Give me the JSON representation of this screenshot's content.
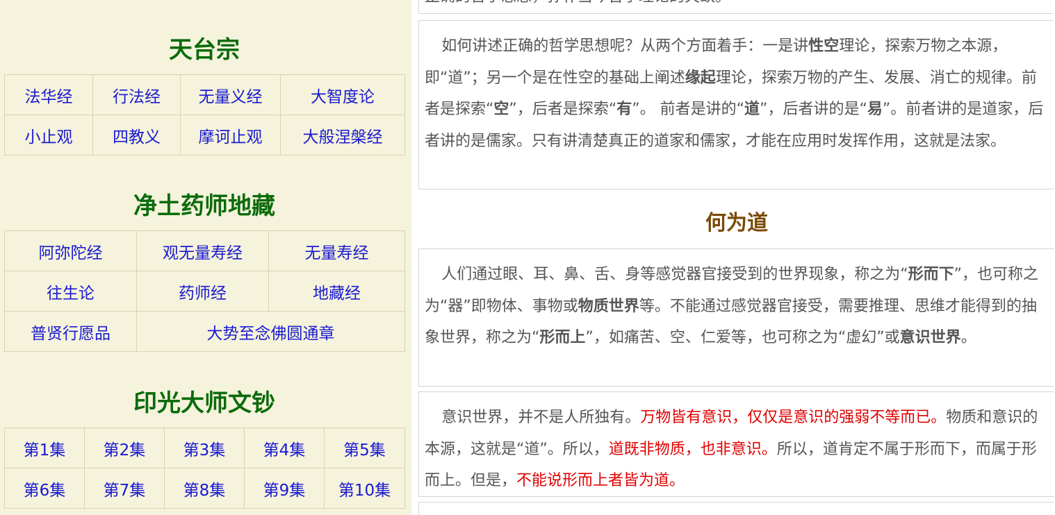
{
  "sidebar": {
    "sections": [
      {
        "title": "天台宗",
        "rows": [
          [
            "法华经",
            "行法经",
            "无量义经",
            "大智度论"
          ],
          [
            "小止观",
            "四教义",
            "摩诃止观",
            "大般涅槃经"
          ]
        ]
      },
      {
        "title": "净土药师地藏",
        "rows": [
          [
            "阿弥陀经",
            "观无量寿经",
            "无量寿经"
          ],
          [
            "往生论",
            "药师经",
            "地藏经"
          ],
          [
            "普贤行愿品",
            "大势至念佛圆通章"
          ]
        ]
      },
      {
        "title": "印光大师文钞",
        "rows": [
          [
            "第1集",
            "第2集",
            "第3集",
            "第4集",
            "第5集"
          ],
          [
            "第6集",
            "第7集",
            "第8集",
            "第9集",
            "第10集"
          ]
        ]
      }
    ]
  },
  "main": {
    "top_fragment": "正确的哲学思想，弥补当今哲学理论的欠缺。",
    "para1": {
      "t1": "如何讲述正确的哲学思想呢？从两个方面着手：一是讲",
      "b1": "性空",
      "t2": "理论，探索万物之本源，即“道”；另一个是在性空的基础上阐述",
      "b2": "缘起",
      "t3": "理论，探索万物的产生、发展、消亡的规律。前者是探索“",
      "b3": "空",
      "t4": "”，后者是探索“",
      "b4": "有",
      "t5": "”。 前者是讲的“",
      "b5": "道",
      "t6": "”，后者讲的是“",
      "b6": "易",
      "t7": "”。前者讲的是道家，后者讲的是儒家。只有讲清楚真正的道家和儒家，才能在应用时发挥作用，这就是法家。"
    },
    "heading": "何为道",
    "para2": {
      "t1": "人们通过眼、耳、鼻、舌、身等感觉器官接受到的世界现象，称之为“",
      "b1": "形而下",
      "t2": "”，也可称之为“器”即物体、事物或",
      "b2": "物质世界",
      "t3": "等。不能通过感觉器官接受，需要推理、思维才能得到的抽象世界，称之为“",
      "b3": "形而上",
      "t4": "”，如痛苦、空、仁爱等，也可称之为“虚幻”或",
      "b4": "意识世界",
      "t5": "。"
    },
    "para3": {
      "t1": "意识世界，并不是人所独有。",
      "r1": "万物皆有意识，仅仅是意识的强弱不等而已。",
      "t2": "物质和意识的本源，这就是“道”。所以，",
      "r2": "道既非物质，也非意识。",
      "t3": "所以，道肯定不属于形而下，而属于形而上。但是，",
      "r3": "不能说形而上者皆为道。"
    }
  }
}
